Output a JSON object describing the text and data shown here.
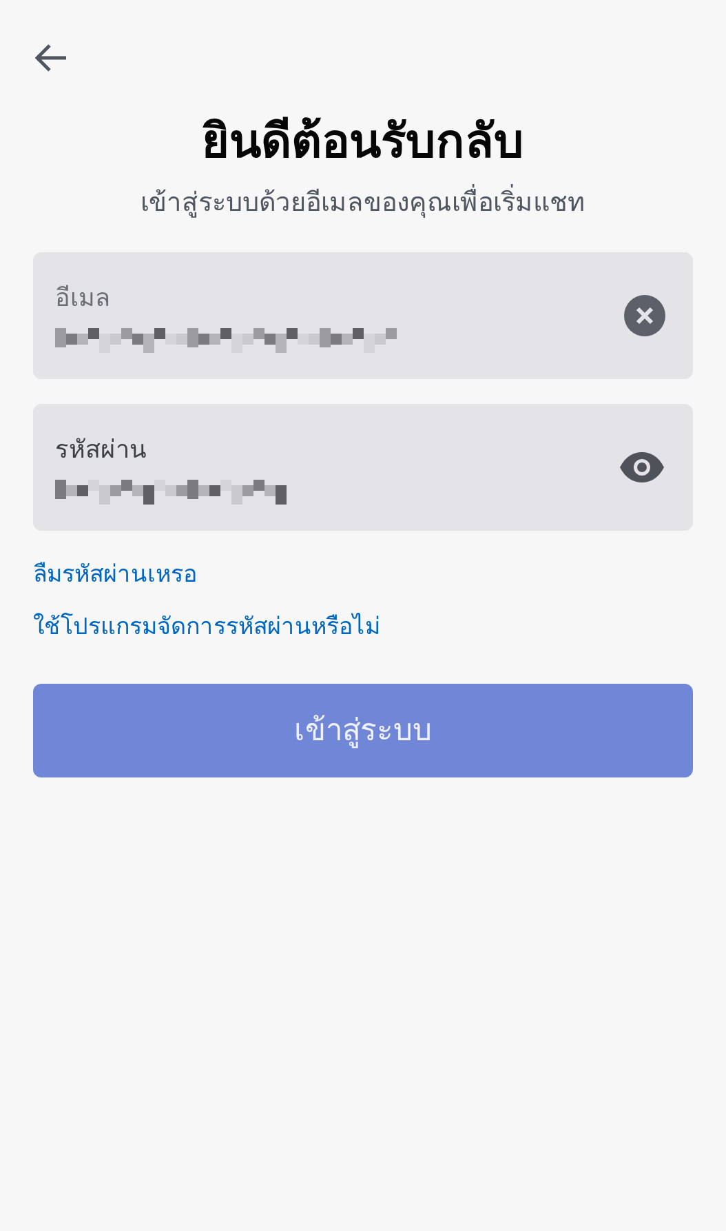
{
  "title": "ยินดีต้อนรับกลับ",
  "subtitle": "เข้าสู่ระบบด้วยอีเมลของคุณเพื่อเริ่มแชท",
  "fields": [
    {
      "kind": "email",
      "label": "อีเมล"
    },
    {
      "kind": "password",
      "label": "รหัสผ่าน"
    }
  ],
  "links": [
    "ลืมรหัสผ่านเหรอ",
    "ใช้โปรแกรมจัดการรหัสผ่านหรือไม่"
  ],
  "submit": {
    "label": "เข้าสู่ระบบ",
    "disabled": true
  }
}
